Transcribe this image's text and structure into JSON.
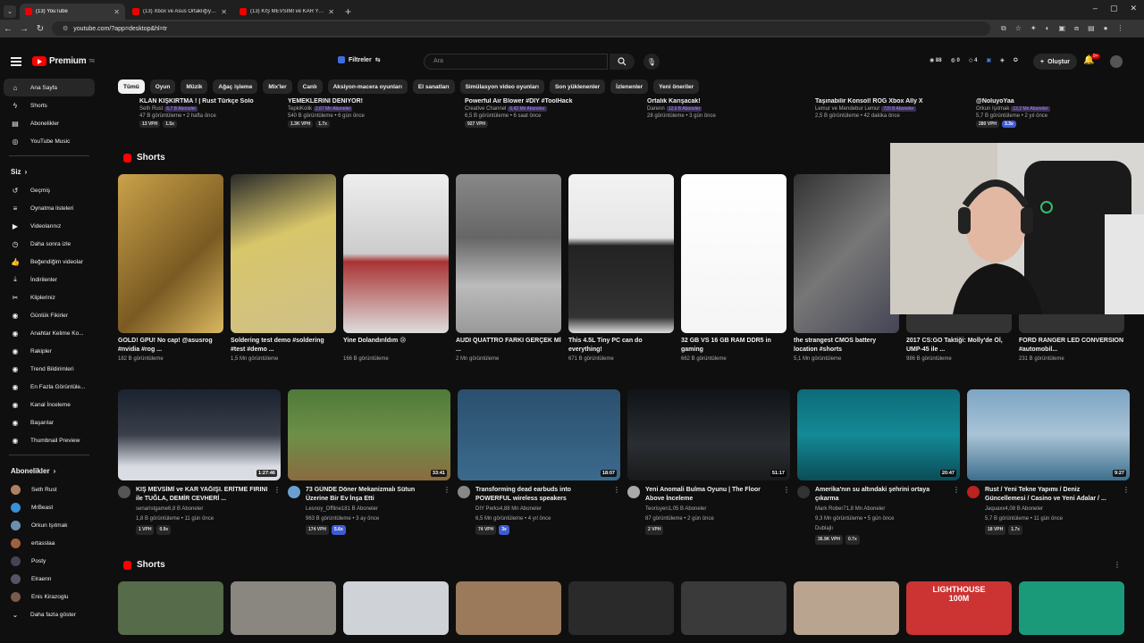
{
  "browser": {
    "tabs": [
      {
        "title": "(13) YouTube",
        "active": true
      },
      {
        "title": "(13) Xbox ve Asus Ortaklığıyla G...",
        "active": false
      },
      {
        "title": "(13) KIŞ MEVSİMİ ve KAR YAĞI...",
        "active": false
      }
    ],
    "url": "youtube.com/?app=desktop&hl=tr"
  },
  "header": {
    "logo_text": "Premium",
    "logo_sup": "TR",
    "filter_label": "Filtreler",
    "search_placeholder": "Ara",
    "stats": [
      "88",
      "0",
      "4"
    ],
    "create_label": "Oluştur",
    "notif_badge": "9+"
  },
  "chips": [
    "Tümü",
    "Oyun",
    "Müzik",
    "Ağaç işleme",
    "Mix'ler",
    "Canlı",
    "Aksiyon-macera oyunları",
    "El sanatları",
    "Simülasyon video oyunları",
    "Son yüklenenler",
    "İzlenenler",
    "Yeni öneriler"
  ],
  "sidebar": {
    "main": [
      {
        "label": "Ana Sayfa",
        "icon": "home-icon",
        "glyph": "⌂"
      },
      {
        "label": "Shorts",
        "icon": "shorts-icon",
        "glyph": "ϟ"
      },
      {
        "label": "Abonelikler",
        "icon": "subscriptions-icon",
        "glyph": "▤"
      },
      {
        "label": "YouTube Music",
        "icon": "music-icon",
        "glyph": "◎"
      }
    ],
    "you_label": "Siz",
    "you": [
      {
        "label": "Geçmiş",
        "icon": "history-icon",
        "glyph": "↺"
      },
      {
        "label": "Oynatma listeleri",
        "icon": "playlist-icon",
        "glyph": "≡"
      },
      {
        "label": "Videolarınız",
        "icon": "your-videos-icon",
        "glyph": "▶"
      },
      {
        "label": "Daha sonra izle",
        "icon": "watch-later-icon",
        "glyph": "◷"
      },
      {
        "label": "Beğendiğim videolar",
        "icon": "like-icon",
        "glyph": "👍"
      },
      {
        "label": "İndirilenler",
        "icon": "download-icon",
        "glyph": "⤓"
      },
      {
        "label": "Klipleriniz",
        "icon": "clips-icon",
        "glyph": "✂"
      },
      {
        "label": "Günlük Fikirler",
        "icon": "ideas-icon",
        "glyph": "◉"
      },
      {
        "label": "Anahtar Kelime Ko...",
        "icon": "keyword-icon",
        "glyph": "◉"
      },
      {
        "label": "Rakipler",
        "icon": "competitors-icon",
        "glyph": "◉"
      },
      {
        "label": "Trend Bildirimleri",
        "icon": "trend-icon",
        "glyph": "◉"
      },
      {
        "label": "En Fazla Görüntüle...",
        "icon": "most-viewed-icon",
        "glyph": "◉"
      },
      {
        "label": "Kanal İnceleme",
        "icon": "channel-review-icon",
        "glyph": "◉"
      },
      {
        "label": "Başarılar",
        "icon": "achievements-icon",
        "glyph": "◉"
      },
      {
        "label": "Thumbnail Preview",
        "icon": "thumbnail-preview-icon",
        "glyph": "◉"
      }
    ],
    "subs_label": "Abonelikler",
    "subs": [
      {
        "label": "Seth Rust",
        "color": "#b08060"
      },
      {
        "label": "MrBeast",
        "color": "#3a8fd6"
      },
      {
        "label": "Orkun Işıtmak",
        "color": "#6c8fb0"
      },
      {
        "label": "ertasslaa",
        "color": "#a06040"
      },
      {
        "label": "Posty",
        "color": "#445"
      },
      {
        "label": "Elraenn",
        "color": "#556"
      },
      {
        "label": "Enis Kirazoglu",
        "color": "#7a5a4a"
      }
    ],
    "more_label": "Daha fazla göster"
  },
  "top_cut": [
    {
      "title": "KLAN KIŞKIRTMA ! | Rust Türkçe Solo",
      "channel": "Seth Rust",
      "badge": "6,7 B Aboneler",
      "meta": "47 B görüntüleme • 2 hafta önce",
      "pills": [
        "13 VPH",
        "1.5x"
      ]
    },
    {
      "title": "YEMEKLERİNİ DENİYOR!",
      "channel": "TepkiKolik",
      "badge": "2,67 Mn Aboneler",
      "meta": "540 B görüntüleme • 6 gün önce",
      "pills": [
        "1.3K VPH",
        "1.7x"
      ]
    },
    {
      "title": "Powerful Air Blower #DIY #ToolHack",
      "channel": "Creative Channel",
      "badge": "6,42 Mn Aboneler",
      "meta": "6,5 B görüntüleme • 6 saat önce",
      "pills": [
        "927 VPH"
      ]
    },
    {
      "title": "Ortalık Karışacak!",
      "channel": "Darenn",
      "badge": "12,6 B Aboneler",
      "meta": "28 görüntüleme • 3 gün önce",
      "pills": []
    },
    {
      "title": "Taşınabilir Konsol! ROG Xbox Ally X",
      "channel": "Lemur ve Mendebur Lemur",
      "badge": "720 B Aboneler",
      "meta": "2,5 B görüntüleme • 42 dakika önce",
      "pills": []
    },
    {
      "title": "@NoluyoYaa",
      "channel": "Orkun Işıtmak",
      "badge": "12,2 Mn Aboneler",
      "meta": "5,7 B görüntüleme • 2 yıl önce",
      "pills": [
        "280 VPH",
        "3.3x"
      ]
    }
  ],
  "shorts_label": "Shorts",
  "shorts": [
    {
      "title": "GOLD! GPU! No cap! @asusrog #nvidia #rog ...",
      "views": "182 B görüntüleme",
      "bg": "linear-gradient(135deg,#c9a24a,#7a5a22 60%,#d9b860)"
    },
    {
      "title": "Soldering test demo #soldering #test #demo ...",
      "views": "1,5 Mn görüntüleme",
      "bg": "linear-gradient(160deg,#2a2a2a,#d8c66a 40%,#cfc08a)"
    },
    {
      "title": "Yine Dolandırıldım 😢",
      "views": "166 B görüntüleme",
      "bg": "linear-gradient(180deg,#eee,#ccc 50%,#a33 55%,#ddd)"
    },
    {
      "title": "AUDI QUATTRO FARKI GERÇEK Mİ ...",
      "views": "2 Mn görüntüleme",
      "bg": "linear-gradient(180deg,#888,#666 40%,#bbb 70%,#999)"
    },
    {
      "title": "This 4.5L Tiny PC can do everything!",
      "views": "671 B görüntüleme",
      "bg": "linear-gradient(180deg,#f2f2f2,#e6e6e6 40%,#222 45%,#333 90%,#ddd)"
    },
    {
      "title": "32 GB VS 16 GB RAM DDR5 in gaming",
      "views": "662 B görüntüleme",
      "bg": "linear-gradient(180deg,#fff,#f5f5f5)"
    },
    {
      "title": "the strangest CMOS battery location #shorts",
      "views": "5,1 Mn görüntüleme",
      "bg": "linear-gradient(135deg,#333,#777 50%,#445)"
    },
    {
      "title": "2017 CS:GO Taktiği: Molly'de Öl, UMP-45 ile ...",
      "views": "986 B görüntüleme",
      "bg": "#333"
    },
    {
      "title": "FORD RANGER LED CONVERSION #automobil...",
      "views": "231 B görüntüleme",
      "bg": "#333"
    }
  ],
  "videos": [
    {
      "title": "KIŞ MEVSİMİ ve KAR YAĞIŞI. ERİTME FIRINI ile TUĞLA, DEMİR CEVHERİ ...",
      "channel": "senaristgame",
      "badge": "6,8 B Aboneler",
      "meta": "1,8 B görüntüleme • 11 gün önce",
      "pills": [
        "1 VPH",
        "0.9x"
      ],
      "duration": "1:27:46",
      "bg": "linear-gradient(180deg,#1b2330,#3a3f4a 50%,#d9dde3 85%)",
      "av": "#555"
    },
    {
      "title": "73 GÜNDE Döner Mekanizmalı Sütun Üzerine Bir Ev İnşa Etti",
      "channel": "Lesnoy_Offline",
      "badge": "181 B Aboneler",
      "meta": "963 B görüntüleme • 3 ay önce",
      "pills": [
        "174 VPH",
        "5.6x"
      ],
      "duration": "33:41",
      "bg": "linear-gradient(180deg,#4f7a3a,#6d8f48 50%,#8a6b40)",
      "av": "#6aa0d0"
    },
    {
      "title": "Transforming dead earbuds into POWERFUL wireless speakers",
      "channel": "DIY Perks",
      "badge": "4,88 Mn Aboneler",
      "meta": "6,5 Mn görüntüleme • 4 yıl önce",
      "pills": [
        "74 VPH",
        "3x"
      ],
      "duration": "18:07",
      "bg": "linear-gradient(180deg,#2c4f6e,#3b6a8c)",
      "av": "#888"
    },
    {
      "title": "Yeni Anomali Bulma Oyunu | The Floor Above İnceleme",
      "channel": "Teorisyen",
      "badge": "1,05 B Aboneler",
      "meta": "87 görüntüleme • 2 gün önce",
      "pills": [
        "2 VPH"
      ],
      "duration": "51:17",
      "bg": "linear-gradient(180deg,#101418,#2a2e33 60%,#1a1a1a)",
      "av": "#aaa"
    },
    {
      "title": "Amerika'nın su altındaki şehrini ortaya çıkarma",
      "channel": "Mark Rober",
      "badge": "71,8 Mn Aboneler",
      "meta": "9,3 Mn görüntüleme • 5 gün önce",
      "pills": [
        "36.9K VPH",
        "0.7x"
      ],
      "duration": "20:47",
      "bg": "linear-gradient(180deg,#0e6b78,#138a96 50%,#0a4d57)",
      "av": "#333",
      "dub": "Dublajlı"
    },
    {
      "title": "Rust / Yeni Tekne Yapımı / Deniz Güncellemesi / Casino ve Yeni Adalar / ...",
      "channel": "Jaquaxx",
      "badge": "4,08 B Aboneler",
      "meta": "5,7 B görüntüleme • 11 gün önce",
      "pills": [
        "18 VPH",
        "1.7x"
      ],
      "duration": "9:27",
      "bg": "linear-gradient(180deg,#7da6c4,#a9c3d6 50%,#3d6f8e)",
      "av": "#b22"
    }
  ],
  "bottom_shorts_label": "Shorts",
  "bottom_shorts_bg": [
    "#556b4a",
    "#8a8680",
    "#cfd2d6",
    "#9a7a5a",
    "#2a2a2a",
    "#3a3a3a",
    "#b9a490",
    "#c33",
    "#1b9a7a"
  ],
  "bottom_short_text": "LIGHTHOUSE 100M"
}
